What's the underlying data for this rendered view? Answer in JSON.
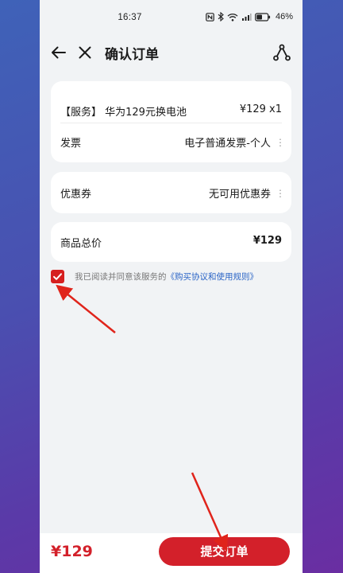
{
  "status_bar": {
    "time": "16:37",
    "battery": "46%"
  },
  "nav": {
    "title": "确认订单"
  },
  "order": {
    "service_item": "【服务】 华为129元换电池",
    "service_price": "¥129 x1",
    "invoice_label": "发票",
    "invoice_value": "电子普通发票-个人"
  },
  "coupon": {
    "label": "优惠券",
    "value": "无可用优惠券"
  },
  "total": {
    "label": "商品总价",
    "value": "¥129"
  },
  "agreement": {
    "checked": true,
    "text": "我已阅读并同意该服务的",
    "link": "《购买协议和使用规则》"
  },
  "bottom": {
    "price": "¥129",
    "submit_label": "提交订单"
  },
  "colors": {
    "accent": "#d3202a",
    "link": "#2a64c6",
    "annotation_arrow": "#e0241b"
  },
  "icons": [
    "back-arrow-icon",
    "close-icon",
    "share-icon",
    "more-dots-icon",
    "checkmark-icon",
    "nfc-icon",
    "bluetooth-icon",
    "wifi-icon",
    "signal-icon",
    "battery-icon"
  ]
}
